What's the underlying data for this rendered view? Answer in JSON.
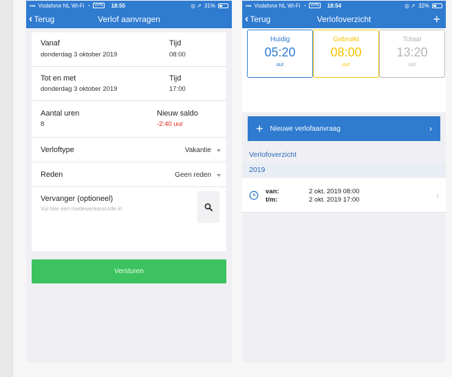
{
  "left_screen": {
    "status": {
      "carrier": "Vodafone NL Wi-Fi",
      "network": "VPN",
      "time": "18:55",
      "battery": "31%",
      "battery_fraction": 0.31
    },
    "nav": {
      "back": "Terug",
      "title": "Verlof aanvragen"
    },
    "vanaf": {
      "label": "Vanaf",
      "date": "donderdag 3 oktober 2019",
      "time_label": "Tijd",
      "time": "08:00"
    },
    "tot_en_met": {
      "label": "Tot en met",
      "date": "donderdag 3 oktober 2019",
      "time_label": "Tijd",
      "time": "17:00"
    },
    "aantal_uren": {
      "label": "Aantal uren",
      "value": "8",
      "saldo_label": "Nieuw saldo",
      "saldo": "-2:40 uur"
    },
    "verloftype": {
      "label": "Verloftype",
      "value": "Vakantie"
    },
    "reden": {
      "label": "Reden",
      "value": "Geen reden"
    },
    "vervanger": {
      "label": "Vervanger (optioneel)",
      "placeholder": "Vul hier een medewerkerscode in"
    },
    "submit": "Versturen"
  },
  "right_screen": {
    "status": {
      "carrier": "Vodafone NL Wi-Fi",
      "network": "VPN",
      "time": "18:54",
      "battery": "32%",
      "battery_fraction": 0.32
    },
    "nav": {
      "back": "Terug",
      "title": "Verlofoverzicht",
      "plus": "+"
    },
    "counters": [
      {
        "label": "Huidig",
        "value": "05:20",
        "unit": "uur",
        "color": "#2e7bd0"
      },
      {
        "label": "Gebruikt",
        "value": "08:00",
        "unit": "uur",
        "color": "#f5c400"
      },
      {
        "label": "Totaal",
        "value": "13:20",
        "unit": "uur",
        "color": "#b5b5ba"
      }
    ],
    "new_request": "Nieuwe verlofaanvraag",
    "section_title": "Verlofoverzicht",
    "year": "2019",
    "entry": {
      "van_label": "van:",
      "van": "2 okt. 2019 08:00",
      "tm_label": "t/m:",
      "tm": "2 okt. 2019 17:00"
    }
  },
  "colors": {
    "brand_blue": "#2e7bd0",
    "submit_green": "#3cc35f",
    "negative_red": "#e2231a"
  }
}
